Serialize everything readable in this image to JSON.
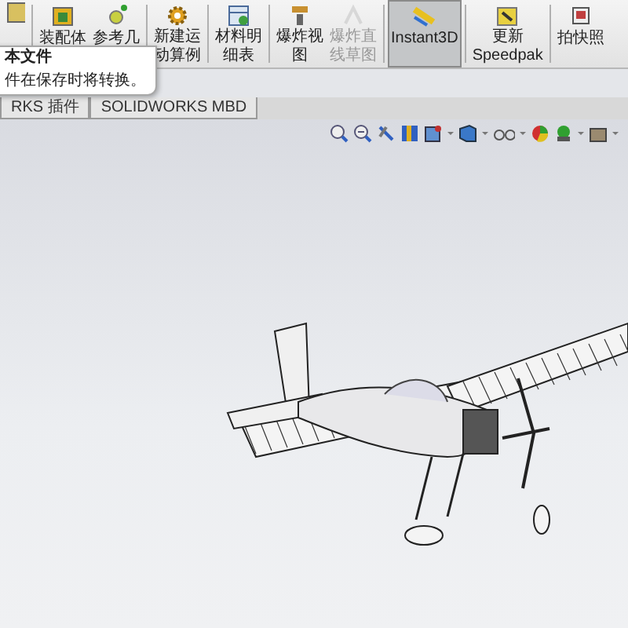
{
  "toolbar": {
    "buttons": [
      {
        "kind": "assembly",
        "lines": [
          "装配体"
        ],
        "selected": false,
        "disabled": false
      },
      {
        "kind": "reference",
        "lines": [
          "参考几"
        ],
        "selected": false,
        "disabled": false
      },
      {
        "kind": "motion",
        "lines": [
          "新建运",
          "动算例"
        ],
        "selected": false,
        "disabled": false
      },
      {
        "kind": "bom",
        "lines": [
          "材料明",
          "细表"
        ],
        "selected": false,
        "disabled": false
      },
      {
        "kind": "explode",
        "lines": [
          "爆炸视",
          "图"
        ],
        "selected": false,
        "disabled": false
      },
      {
        "kind": "sketch",
        "lines": [
          "爆炸直",
          "线草图"
        ],
        "selected": false,
        "disabled": true
      },
      {
        "kind": "instant3d",
        "lines": [
          "Instant3D"
        ],
        "selected": true,
        "disabled": false
      },
      {
        "kind": "speedpak",
        "lines": [
          "更新",
          "Speedpak"
        ],
        "selected": false,
        "disabled": false
      },
      {
        "kind": "snapshot",
        "lines": [
          "拍快照"
        ],
        "selected": false,
        "disabled": false
      }
    ]
  },
  "tabs": [
    {
      "label": "RKS 插件",
      "selected": false
    },
    {
      "label": "SOLIDWORKS MBD",
      "selected": false
    }
  ],
  "tooltip": {
    "title": "本文件",
    "text": "件在保存时将转换。"
  }
}
